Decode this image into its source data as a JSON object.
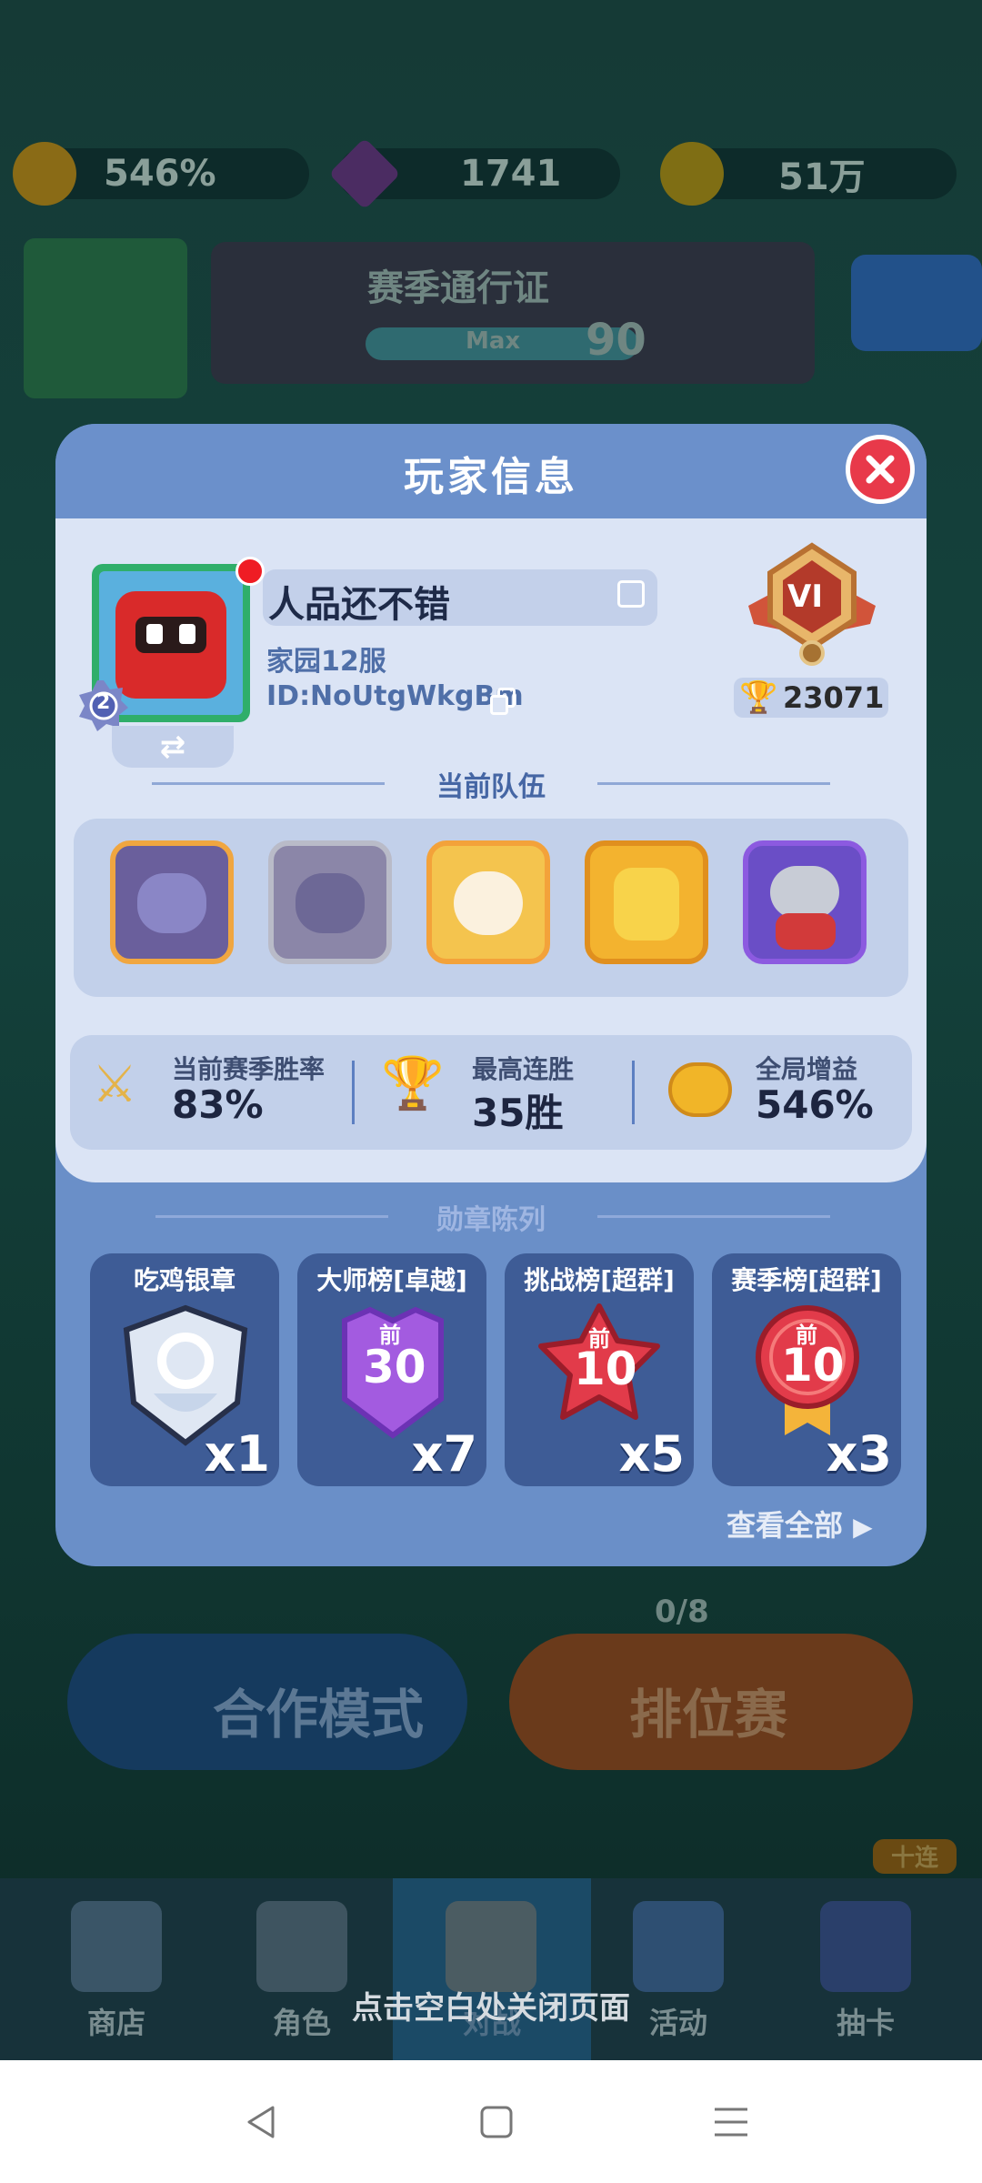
{
  "top_bar": {
    "boost": "546%",
    "gems": "1741",
    "coins": "51万"
  },
  "pass_banner": {
    "title": "赛季通行证",
    "bar_label": "Max",
    "level": "90",
    "avatar_rank": "2"
  },
  "modal": {
    "title": "玩家信息",
    "player": {
      "name": "人品还不错",
      "server": "家园12服",
      "id": "ID:NoUtgWkgBm",
      "rank_badge": "VI",
      "avatar_level": "2",
      "trophies": "23071"
    },
    "team_section_title": "当前队伍",
    "stats": [
      {
        "label": "当前赛季胜率",
        "value": "83%"
      },
      {
        "label": "最高连胜",
        "value": "35胜"
      },
      {
        "label": "全局增益",
        "value": "546%"
      }
    ],
    "medal_section_title": "勋章陈列",
    "medals": [
      {
        "name": "吃鸡银章",
        "count": "x1",
        "badge_text": ""
      },
      {
        "name": "大师榜[卓越]",
        "count": "x7",
        "badge_top": "前",
        "badge_num": "30"
      },
      {
        "name": "挑战榜[超群]",
        "count": "x5",
        "badge_top": "前",
        "badge_num": "10"
      },
      {
        "name": "赛季榜[超群]",
        "count": "x3",
        "badge_top": "前",
        "badge_num": "10"
      }
    ],
    "view_all": "查看全部"
  },
  "behind": {
    "progress": "0/8",
    "coop_mode": "合作模式",
    "ranked": "排位赛",
    "ten_pull": "十连"
  },
  "bottom_nav": [
    {
      "label": "商店"
    },
    {
      "label": "角色"
    },
    {
      "label": "对战"
    },
    {
      "label": "活动"
    },
    {
      "label": "抽卡"
    }
  ],
  "close_hint": "点击空白处关闭页面",
  "colors": {
    "accent_red": "#e8394a",
    "modal_blue": "#6a8fc8",
    "panel_light": "#dbe4f5"
  }
}
